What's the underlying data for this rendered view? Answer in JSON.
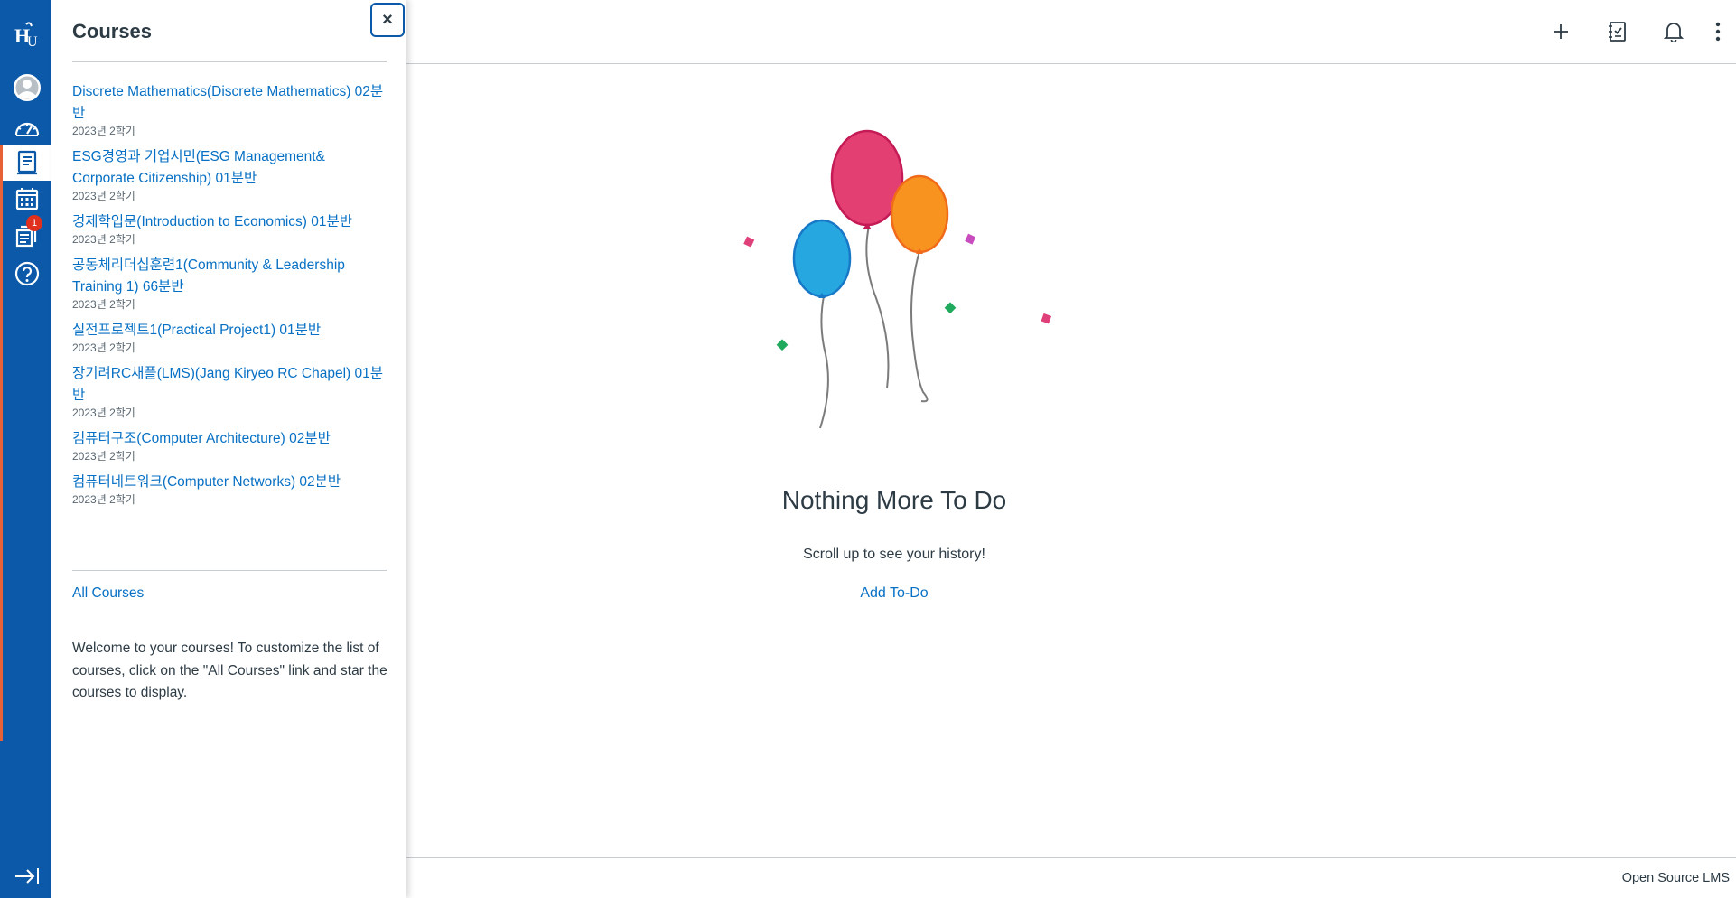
{
  "nav": {
    "logo_text": "HGU",
    "notification_count": "1",
    "brand_color": "#0b59a8",
    "accent_color": "#e66135"
  },
  "tray": {
    "title": "Courses",
    "close_label": "×",
    "courses": [
      {
        "name": "Discrete Mathematics(Discrete Mathematics) 02분반",
        "term": "2023년 2학기"
      },
      {
        "name": "ESG경영과 기업시민(ESG Management& Corporate Citizenship) 01분반",
        "term": "2023년 2학기"
      },
      {
        "name": "경제학입문(Introduction to Economics) 01분반",
        "term": "2023년 2학기"
      },
      {
        "name": "공동체리더십훈련1(Community & Leadership Training 1) 66분반",
        "term": "2023년 2학기"
      },
      {
        "name": "실전프로젝트1(Practical Project1) 01분반",
        "term": "2023년 2학기"
      },
      {
        "name": "장기려RC채플(LMS)(Jang Kiryeo RC Chapel) 01분반",
        "term": "2023년 2학기"
      },
      {
        "name": "컴퓨터구조(Computer Architecture) 02분반",
        "term": "2023년 2학기"
      },
      {
        "name": "컴퓨터네트워크(Computer Networks) 02분반",
        "term": "2023년 2학기"
      }
    ],
    "all_courses_label": "All Courses",
    "welcome_text": "Welcome to your courses! To customize the list of courses, click on the \"All Courses\" link and star the courses to display."
  },
  "main": {
    "empty_title": "Nothing More To Do",
    "empty_subtitle": "Scroll up to see your history!",
    "add_todo_label": "Add To-Do"
  },
  "footer": {
    "text": "Open Source LMS"
  }
}
